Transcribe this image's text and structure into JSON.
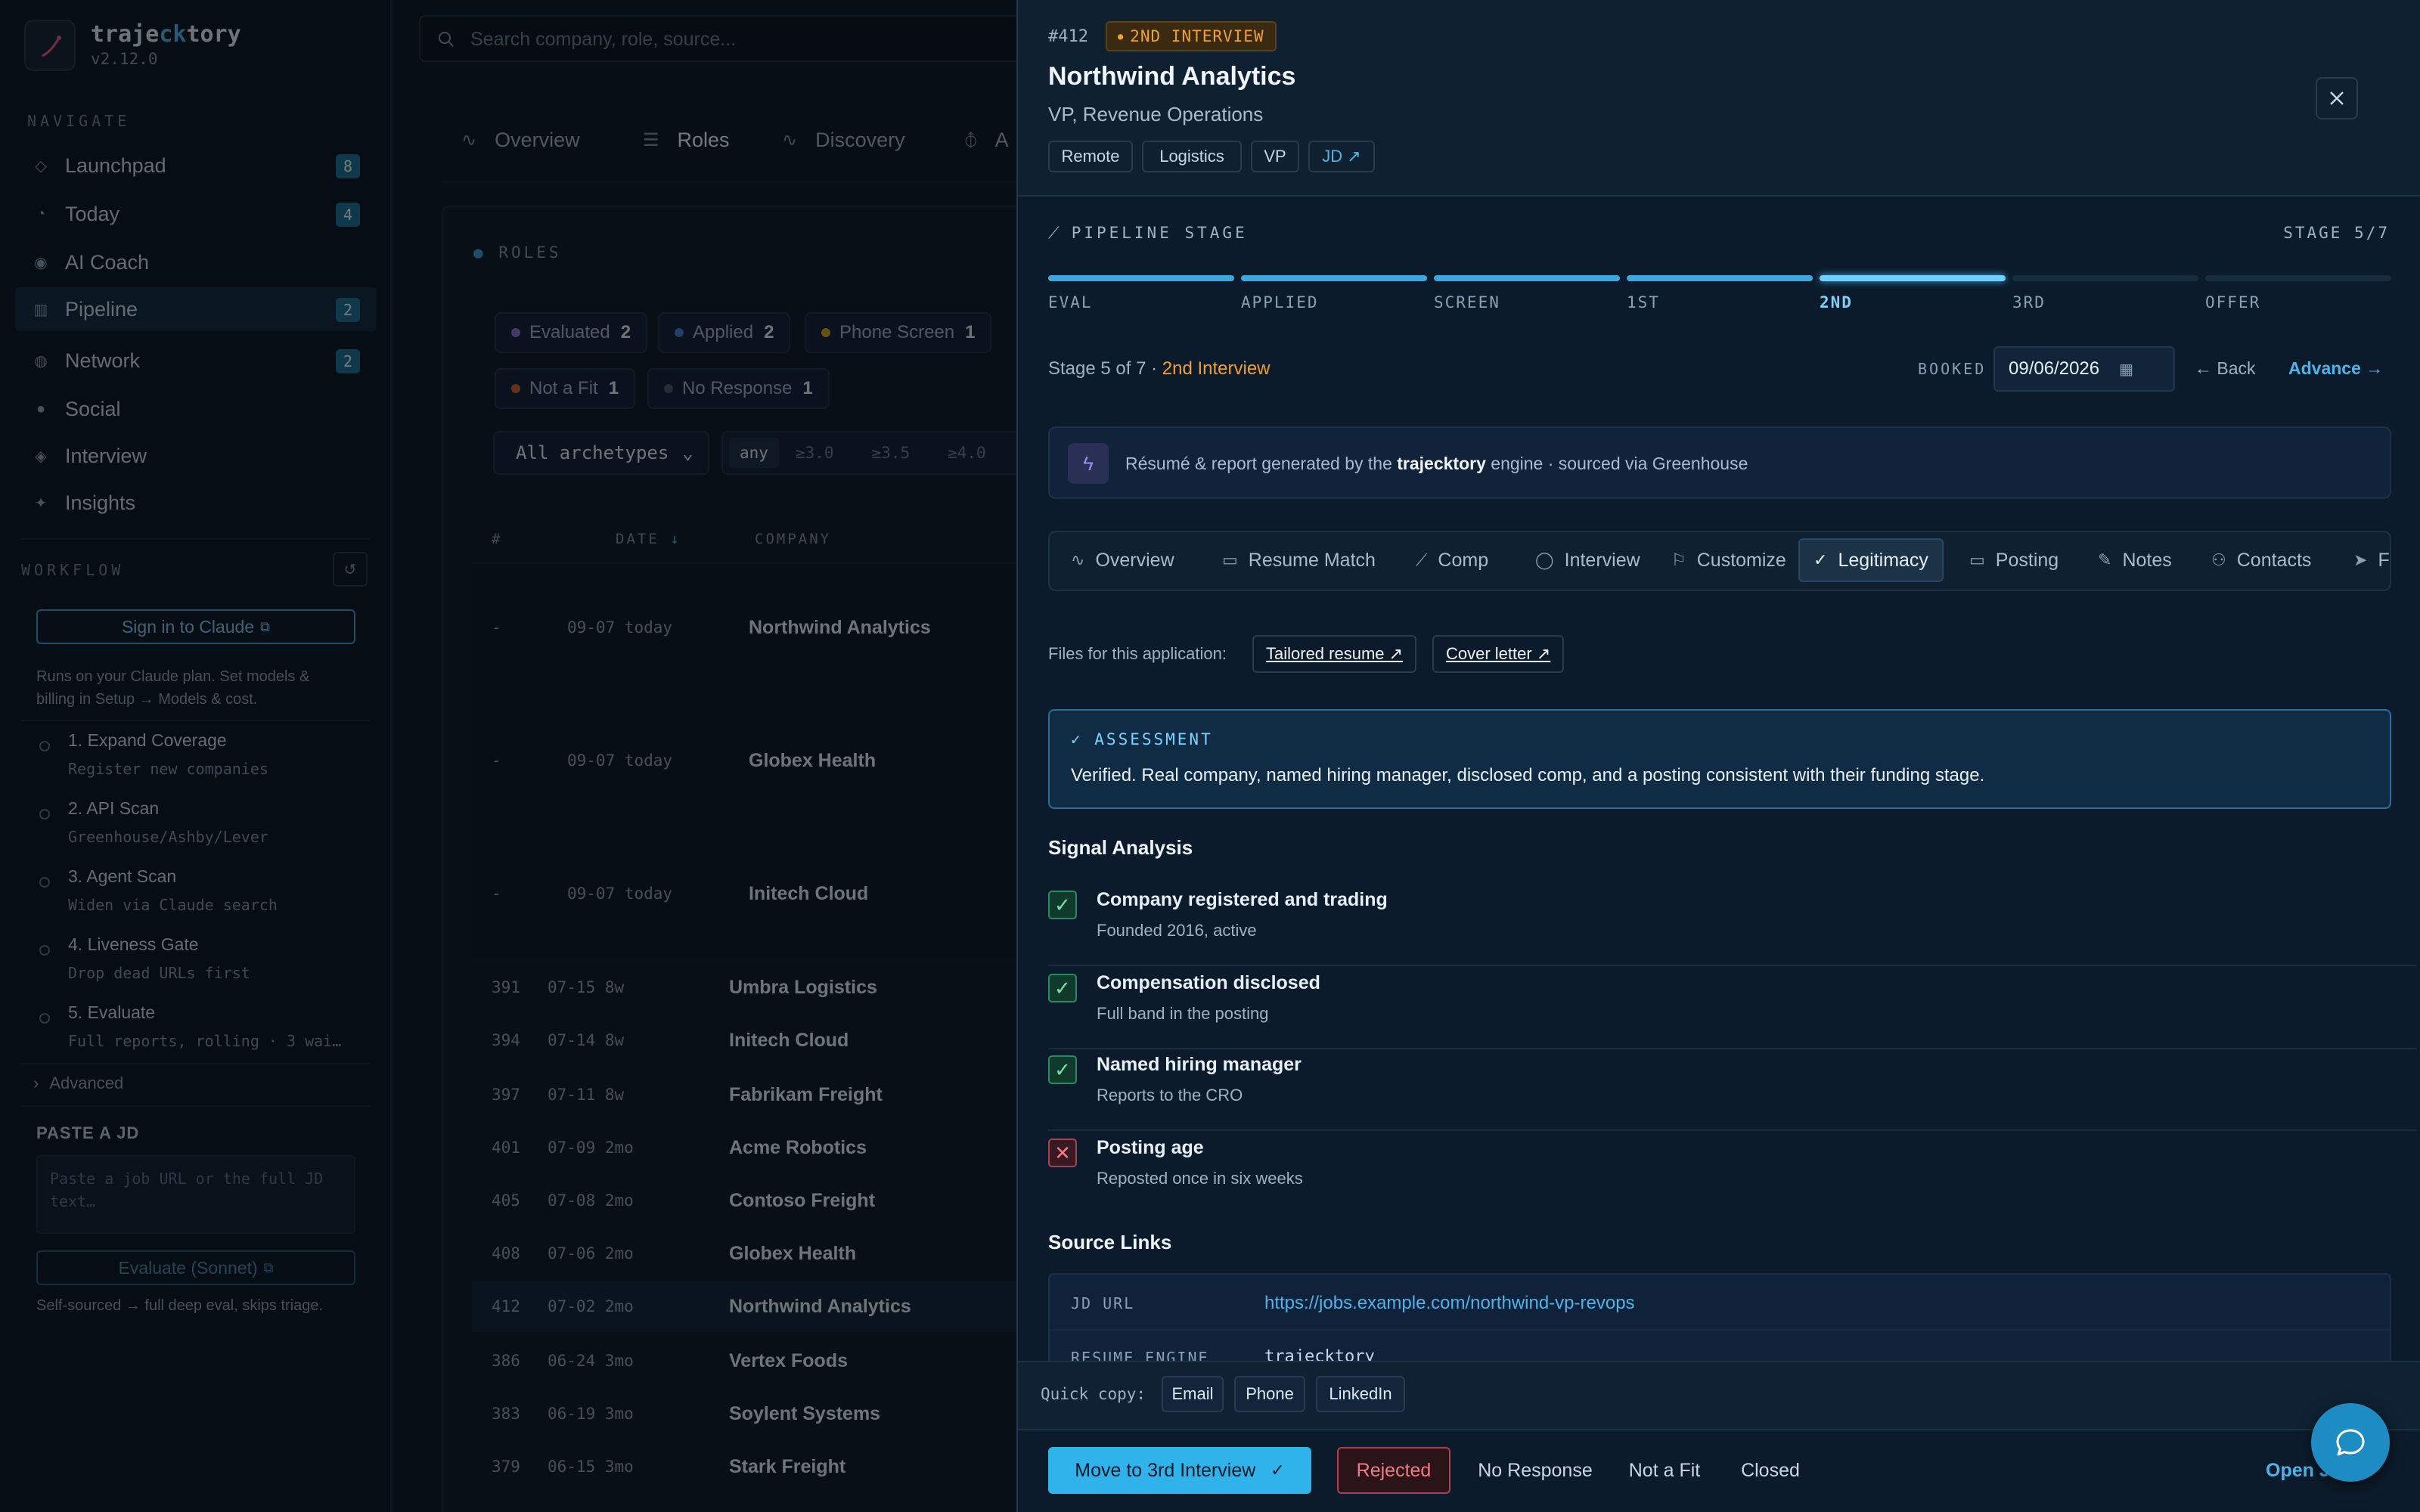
{
  "app": {
    "name_pre": "traje",
    "name_mid": "ck",
    "name_post": "tory",
    "version": "v2.12.0"
  },
  "sidebar": {
    "navigate_title": "NAVIGATE",
    "items": [
      {
        "label": "Launchpad",
        "badge": "8",
        "icon": "rocket-icon"
      },
      {
        "label": "Today",
        "badge": "4",
        "icon": "clock-icon"
      },
      {
        "label": "AI Coach",
        "badge": "",
        "icon": "target-icon"
      },
      {
        "label": "Pipeline",
        "badge": "2",
        "icon": "grid-icon"
      },
      {
        "label": "Network",
        "badge": "2",
        "icon": "globe-icon"
      },
      {
        "label": "Social",
        "badge": "",
        "icon": "circle-icon"
      },
      {
        "label": "Interview",
        "badge": "",
        "icon": "diamond-icon"
      },
      {
        "label": "Insights",
        "badge": "",
        "icon": "sparkle-icon"
      }
    ],
    "workflow_title": "WORKFLOW",
    "sign_in": "Sign in to Claude",
    "plan_text_1": "Runs on your Claude plan. Set models &",
    "plan_text_2": "billing in Setup → Models & cost.",
    "steps": [
      {
        "name": "1. Expand Coverage",
        "desc": "Register new companies"
      },
      {
        "name": "2. API Scan",
        "desc": "Greenhouse/Ashby/Lever"
      },
      {
        "name": "3. Agent Scan",
        "desc": "Widen via Claude search"
      },
      {
        "name": "4. Liveness Gate",
        "desc": "Drop dead URLs first"
      },
      {
        "name": "5. Evaluate",
        "desc": "Full reports, rolling · 3 wai…"
      }
    ],
    "advanced": "Advanced",
    "paste_title": "PASTE A JD",
    "paste_placeholder": "Paste a job URL or the full JD text…",
    "evaluate_btn": "Evaluate (Sonnet)",
    "self_sourced": "Self-sourced → full deep eval, skips triage."
  },
  "main": {
    "search_placeholder": "Search company, role, source...",
    "tabs": [
      "Overview",
      "Roles",
      "Discovery",
      "A"
    ],
    "roles_title": "ROLES",
    "filters": [
      {
        "label": "Evaluated",
        "count": "2",
        "color": "#8a6fd6"
      },
      {
        "label": "Applied",
        "count": "2",
        "color": "#3f7ed0"
      },
      {
        "label": "Phone Screen",
        "count": "1",
        "color": "#c9a227"
      },
      {
        "label": "Not a Fit",
        "count": "1",
        "color": "#c9622f"
      },
      {
        "label": "No Response",
        "count": "1",
        "color": "#4f5d6b"
      }
    ],
    "archetype": "All archetypes",
    "score_filters": [
      "any",
      "≥3.0",
      "≥3.5",
      "≥4.0"
    ],
    "columns": [
      "#",
      "DATE",
      "COMPANY"
    ],
    "rows": [
      {
        "num": "-",
        "date": "09-07 today",
        "company": "Northwind Analytics"
      },
      {
        "num": "-",
        "date": "09-07 today",
        "company": "Globex Health"
      },
      {
        "num": "-",
        "date": "09-07 today",
        "company": "Initech Cloud"
      },
      {
        "num": "391",
        "date": "07-15 8w",
        "company": "Umbra Logistics"
      },
      {
        "num": "394",
        "date": "07-14 8w",
        "company": "Initech Cloud"
      },
      {
        "num": "397",
        "date": "07-11 8w",
        "company": "Fabrikam Freight"
      },
      {
        "num": "401",
        "date": "07-09 2mo",
        "company": "Acme Robotics"
      },
      {
        "num": "405",
        "date": "07-08 2mo",
        "company": "Contoso Freight"
      },
      {
        "num": "408",
        "date": "07-06 2mo",
        "company": "Globex Health"
      },
      {
        "num": "412",
        "date": "07-02 2mo",
        "company": "Northwind Analytics"
      },
      {
        "num": "386",
        "date": "06-24 3mo",
        "company": "Vertex Foods"
      },
      {
        "num": "383",
        "date": "06-19 3mo",
        "company": "Soylent Systems"
      },
      {
        "num": "379",
        "date": "06-15 3mo",
        "company": "Stark Freight"
      }
    ]
  },
  "drawer": {
    "id": "#412",
    "stage_badge": "2ND INTERVIEW",
    "company": "Northwind Analytics",
    "role": "VP, Revenue Operations",
    "tags": [
      "Remote",
      "Logistics",
      "VP",
      "JD ↗"
    ],
    "pipeline_title": "PIPELINE STAGE",
    "stage_count": "STAGE 5/7",
    "stages": [
      "EVAL",
      "APPLIED",
      "SCREEN",
      "1ST",
      "2ND",
      "3RD",
      "OFFER"
    ],
    "stage_text": "Stage 5 of 7 · ",
    "stage_name": "2nd Interview",
    "booked_label": "BOOKED",
    "booked_date": "09/06/2026",
    "back": "← Back",
    "advance": "Advance →",
    "engine_pre": "Résumé & report generated by the ",
    "engine_name": "trajecktory",
    "engine_post": " engine · sourced via Greenhouse",
    "tabs": [
      {
        "label": "Overview",
        "icon": "pulse-icon"
      },
      {
        "label": "Resume Match",
        "icon": "briefcase-icon"
      },
      {
        "label": "Comp",
        "icon": "trend-icon"
      },
      {
        "label": "Interview",
        "icon": "chat-icon"
      },
      {
        "label": "Customize",
        "icon": "flag-icon"
      },
      {
        "label": "Legitimacy",
        "icon": "check-icon"
      },
      {
        "label": "Posting",
        "icon": "briefcase-icon"
      },
      {
        "label": "Notes",
        "icon": "pencil-icon"
      },
      {
        "label": "Contacts",
        "icon": "users-icon"
      },
      {
        "label": "Fo",
        "icon": "send-icon"
      }
    ],
    "files_label": "Files for this application:",
    "files": [
      "Tailored resume ↗",
      "Cover letter ↗"
    ],
    "assessment_title": "✓ ASSESSMENT",
    "assessment_text": "Verified. Real company, named hiring manager, disclosed comp, and a posting consistent with their funding stage.",
    "signal_title": "Signal Analysis",
    "signals": [
      {
        "title": "Company registered and trading",
        "desc": "Founded 2016, active",
        "ok": true
      },
      {
        "title": "Compensation disclosed",
        "desc": "Full band in the posting",
        "ok": true
      },
      {
        "title": "Named hiring manager",
        "desc": "Reports to the CRO",
        "ok": true
      },
      {
        "title": "Posting age",
        "desc": "Reposted once in six weeks",
        "ok": false
      }
    ],
    "source_title": "Source Links",
    "jd_url_label": "JD URL",
    "jd_url": "https://jobs.example.com/northwind-vp-revops",
    "resume_engine_label": "RESUME ENGINE",
    "resume_engine_value": "trajecktory",
    "quick_copy_label": "Quick copy:",
    "quick_copy": [
      "Email",
      "Phone",
      "LinkedIn"
    ],
    "footer": {
      "move": "Move to 3rd Interview",
      "rejected": "Rejected",
      "no_response": "No Response",
      "not_fit": "Not a Fit",
      "closed": "Closed",
      "open": "Open J"
    }
  },
  "colors": {
    "accent": "#4fb3e8",
    "stage_orange": "#f0a030",
    "reject": "#e05a5a",
    "ok": "#2c8a62"
  }
}
